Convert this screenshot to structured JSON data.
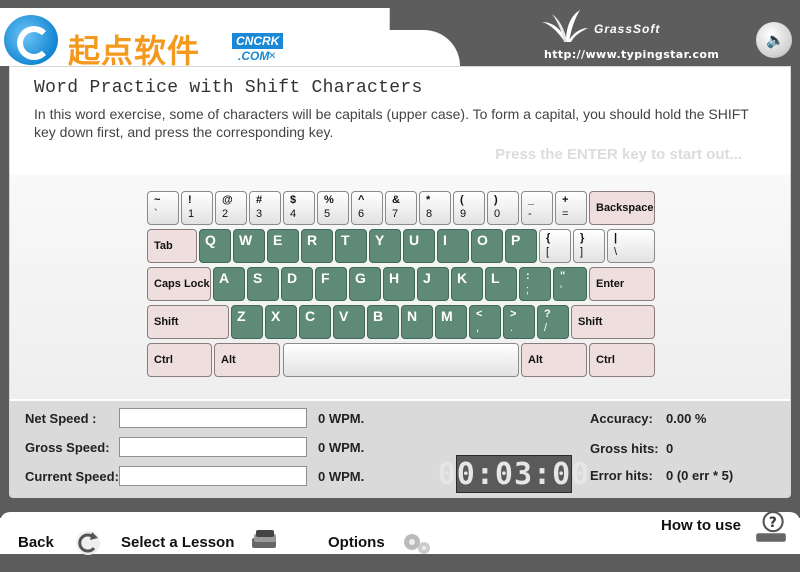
{
  "header": {
    "logo_text": "起点软件",
    "logo_badge": "CNCRK",
    "logo_com": ".COM",
    "brand_name": "GrassSoft",
    "brand_url": "http://www.typingstar.com"
  },
  "exercise": {
    "title": "Word Practice with Shift Characters",
    "description": "In this word exercise, some of characters will be capitals (upper case). To form a capital, you should hold the SHIFT key down first, and press the corresponding key.",
    "prompt": "Press the ENTER key to start out..."
  },
  "keyboard": {
    "row1": [
      {
        "top": "~",
        "bottom": "`"
      },
      {
        "top": "!",
        "bottom": "1"
      },
      {
        "top": "@",
        "bottom": "2"
      },
      {
        "top": "#",
        "bottom": "3"
      },
      {
        "top": "$",
        "bottom": "4"
      },
      {
        "top": "%",
        "bottom": "5"
      },
      {
        "top": "^",
        "bottom": "6"
      },
      {
        "top": "&",
        "bottom": "7"
      },
      {
        "top": "*",
        "bottom": "8"
      },
      {
        "top": "(",
        "bottom": "9"
      },
      {
        "top": ")",
        "bottom": "0"
      },
      {
        "top": "_",
        "bottom": "-"
      },
      {
        "top": "+",
        "bottom": "="
      }
    ],
    "backspace": "Backspace",
    "tab": "Tab",
    "row2": [
      "Q",
      "W",
      "E",
      "R",
      "T",
      "Y",
      "U",
      "I",
      "O",
      "P"
    ],
    "row2_sym": [
      {
        "top": "{",
        "bottom": "["
      },
      {
        "top": "}",
        "bottom": "]"
      },
      {
        "top": "|",
        "bottom": "\\"
      }
    ],
    "caps_lock": "Caps Lock",
    "row3": [
      "A",
      "S",
      "D",
      "F",
      "G",
      "H",
      "J",
      "K",
      "L"
    ],
    "row3_sym": [
      {
        "top": ":",
        "bottom": ";"
      },
      {
        "top": "\"",
        "bottom": "'"
      }
    ],
    "enter": "Enter",
    "shift": "Shift",
    "row4": [
      "Z",
      "X",
      "C",
      "V",
      "B",
      "N",
      "M"
    ],
    "row4_sym": [
      {
        "top": "<",
        "bottom": ","
      },
      {
        "top": ">",
        "bottom": "."
      },
      {
        "top": "?",
        "bottom": "/"
      }
    ],
    "ctrl": "Ctrl",
    "alt": "Alt"
  },
  "stats": {
    "net_speed_label": "Net Speed  :",
    "gross_speed_label": "Gross Speed:",
    "current_speed_label": "Current Speed:",
    "net_speed_value": "0 WPM.",
    "gross_speed_value": "0 WPM.",
    "current_speed_value": "0 WPM.",
    "accuracy_label": "Accuracy:",
    "accuracy_value": "0.00 %",
    "gross_hits_label": "Gross hits:",
    "gross_hits_value": "0",
    "error_hits_label": "Error hits:",
    "error_hits_value": "0 (0 err * 5)",
    "timer": "00:03:00"
  },
  "footer": {
    "back": "Back",
    "select_lesson": "Select a Lesson",
    "options": "Options",
    "how_to_use": "How to use"
  }
}
